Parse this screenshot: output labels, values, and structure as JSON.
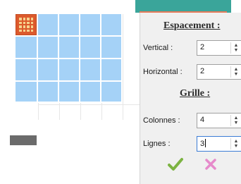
{
  "panel": {
    "spacing_title": "Espacement :",
    "vertical_label": "Vertical :",
    "vertical_value": "2",
    "horizontal_label": "Horizontal :",
    "horizontal_value": "2",
    "grid_title": "Grille :",
    "columns_label": "Colonnes :",
    "columns_value": "4",
    "rows_label": "Lignes :",
    "rows_value": "3"
  },
  "icons": {
    "grid_button": "grid-icon",
    "confirm": "checkmark-icon",
    "cancel": "cross-icon",
    "spin_up": "▲",
    "spin_down": "▼"
  },
  "colors": {
    "cell_fill": "#a5d2f7",
    "grid_button": "#dc5a2c",
    "confirm": "#7cb342",
    "cancel": "#e68acb",
    "accent_bar": "#3aa59a"
  }
}
